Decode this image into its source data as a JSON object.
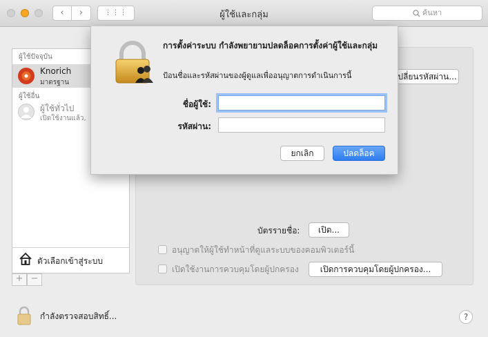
{
  "window": {
    "title": "ผู้ใช้และกลุ่ม"
  },
  "toolbar": {
    "back": "‹",
    "forward": "›",
    "grid": "⋮⋮⋮",
    "search_placeholder": "ค้นหา"
  },
  "sidebar": {
    "current_section": "ผู้ใช้ปัจจุบัน",
    "current_user": {
      "name": "Knorich",
      "role": "มาตรฐาน"
    },
    "other_section": "ผู้ใช้อื่น",
    "guest_user": {
      "name": "ผู้ใช้ทั่วไป",
      "status": "เปิดใช้งานแล้ว,"
    },
    "login_options": "ตัวเลือกเข้าสู่ระบบ",
    "add": "+",
    "remove": "−"
  },
  "main": {
    "change_password_button": "เปลี่ยนรหัสผ่าน...",
    "contact_card_label": "บัตรรายชื่อ:",
    "open_button": "เปิด...",
    "allow_admin_label": "อนุญาตให้ผู้ใช้ทำหน้าที่ดูแลระบบของคอมพิวเตอร์นี้",
    "parental_label": "เปิดใช้งานการควบคุมโดยผู้ปกครอง",
    "parental_button": "เปิดการควบคุมโดยผู้ปกครอง..."
  },
  "footer": {
    "lock_text": "กำลังตรวจสอบสิทธิ์...",
    "help": "?"
  },
  "dialog": {
    "title": "การตั้งค่าระบบ กำลังพยายามปลดล็อคการตั้งค่าผู้ใช้และกลุ่ม",
    "message": "ป้อนชื่อและรหัสผ่านของผู้ดูแลเพื่ออนุญาตการดำเนินการนี้",
    "username_label": "ชื่อผู้ใช้:",
    "password_label": "รหัสผ่าน:",
    "username_value": "",
    "password_value": "",
    "cancel": "ยกเลิก",
    "unlock": "ปลดล็อค"
  },
  "colors": {
    "accent": "#2f7df0",
    "minimize": "#f5a623"
  }
}
